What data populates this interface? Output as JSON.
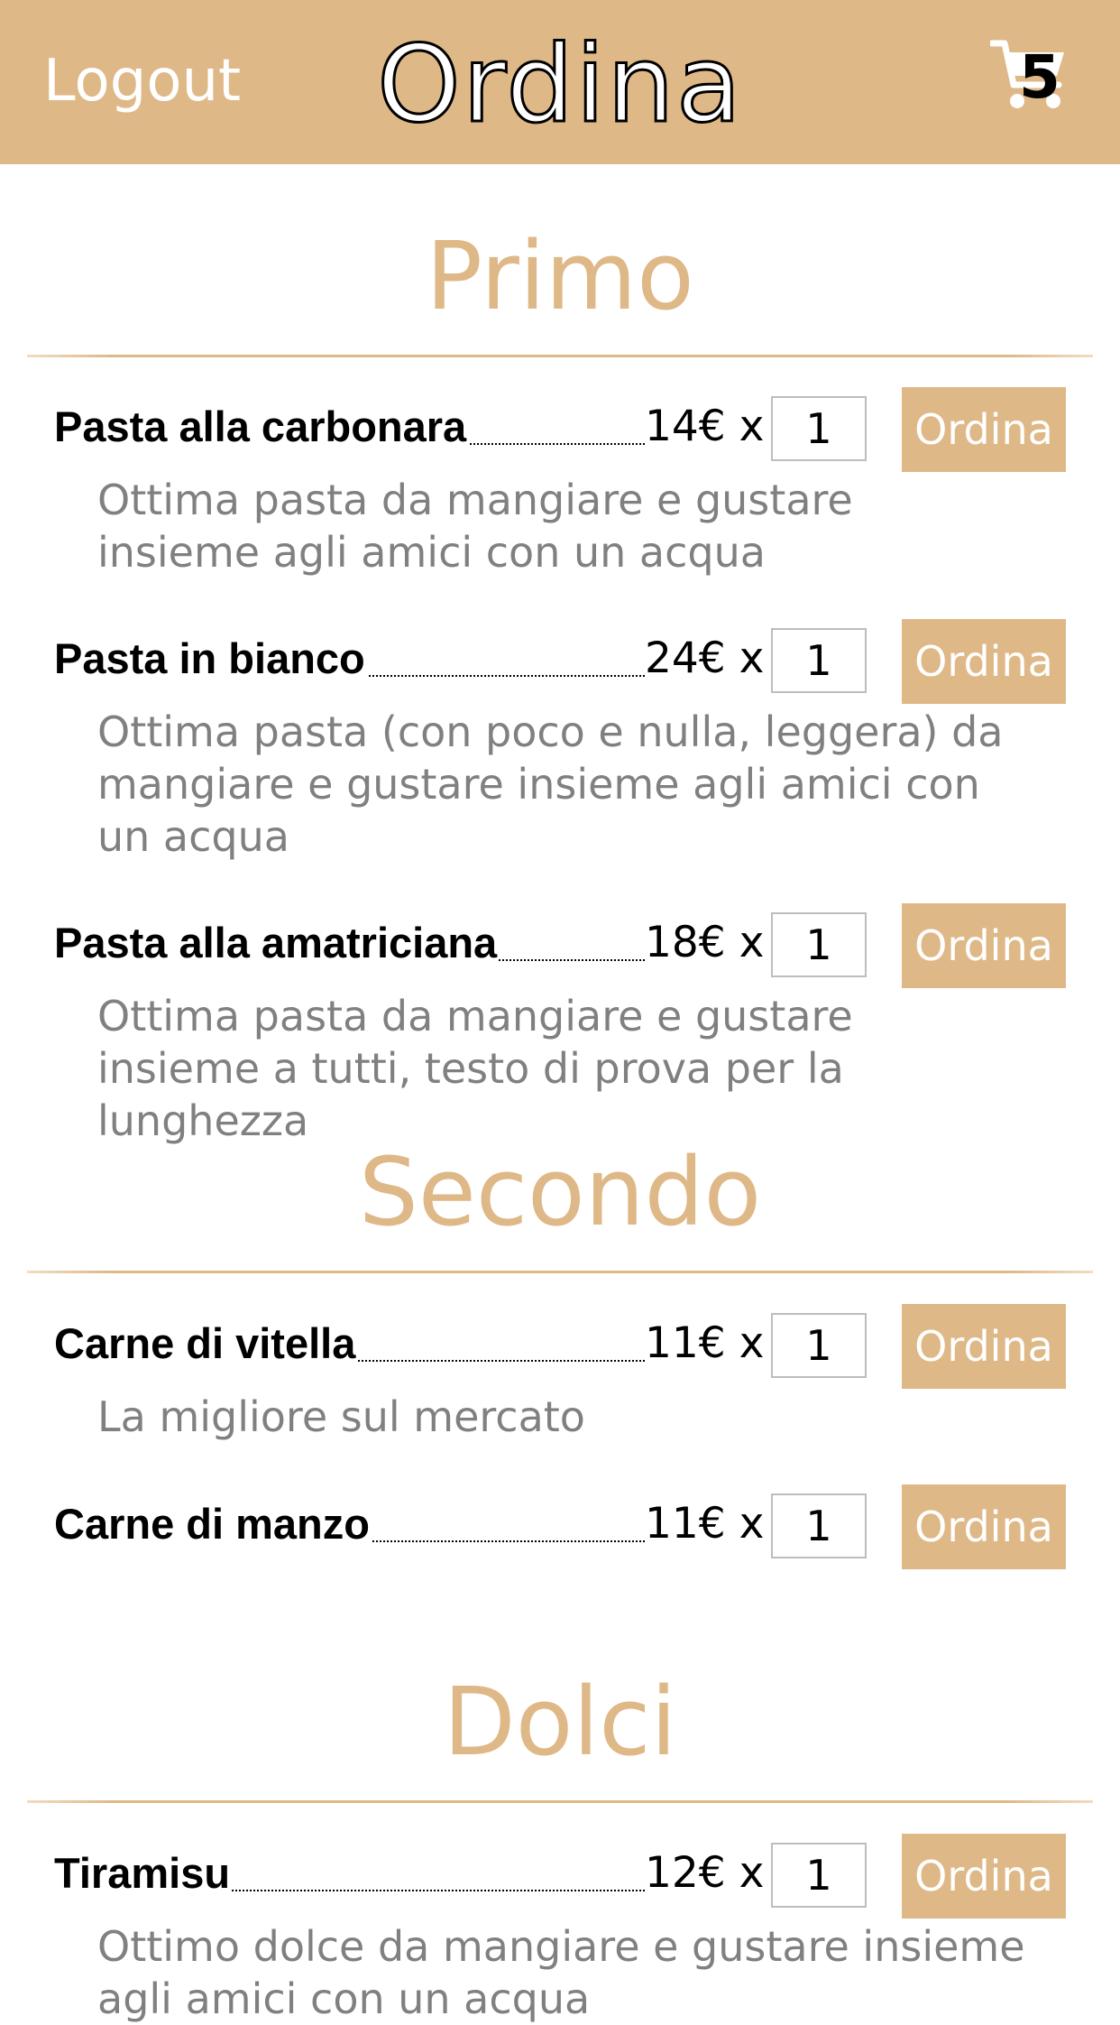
{
  "header": {
    "logout_label": "Logout",
    "title": "Ordina",
    "cart_count": "5",
    "cart_icon": "shopping-cart-icon",
    "bg_color": "#dfb887"
  },
  "colors": {
    "accent": "#dfb887",
    "description": "#808080",
    "text": "#000000"
  },
  "sections": [
    {
      "title": "Primo",
      "items": [
        {
          "name": "Pasta alla carbonara",
          "price": "14€ x",
          "quantity": "1",
          "order_label": "Ordina",
          "description": "Ottima pasta da mangiare e gustare insieme agli amici con un acqua"
        },
        {
          "name": "Pasta in bianco",
          "price": "24€ x",
          "quantity": "1",
          "order_label": "Ordina",
          "description": "Ottima pasta (con poco e nulla, leggera) da mangiare e gustare insieme agli amici con un acqua"
        },
        {
          "name": "Pasta alla amatriciana",
          "price": "18€ x",
          "quantity": "1",
          "order_label": "Ordina",
          "description": "Ottima pasta da mangiare e gustare insieme a tutti, testo di prova per la lunghezza"
        }
      ]
    },
    {
      "title": "Secondo",
      "items": [
        {
          "name": "Carne di vitella",
          "price": "11€ x",
          "quantity": "1",
          "order_label": "Ordina",
          "description": "La migliore sul mercato"
        },
        {
          "name": "Carne di manzo",
          "price": "11€ x",
          "quantity": "1",
          "order_label": "Ordina",
          "description": ""
        }
      ]
    },
    {
      "title": "Dolci",
      "items": [
        {
          "name": "Tiramisu",
          "price": "12€ x",
          "quantity": "1",
          "order_label": "Ordina",
          "description": "Ottimo dolce da mangiare e gustare insieme agli amici con un acqua"
        }
      ]
    }
  ]
}
